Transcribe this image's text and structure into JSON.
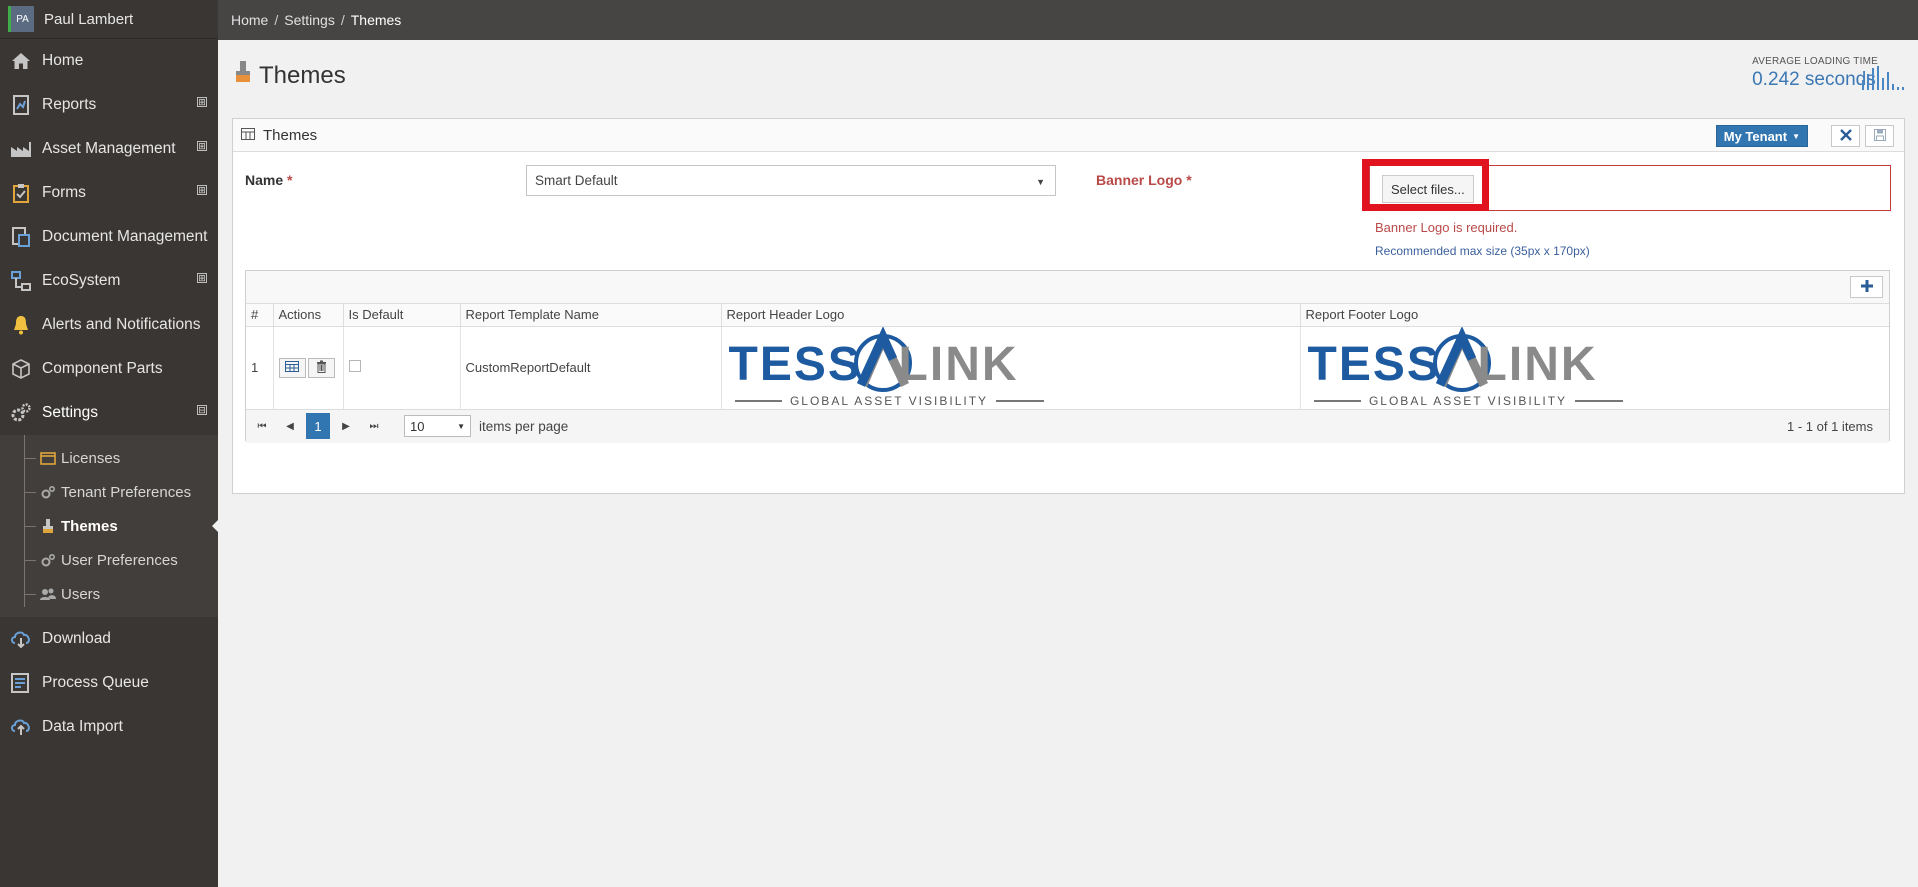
{
  "user": {
    "initials": "PA",
    "name": "Paul Lambert"
  },
  "sidebar": {
    "items": [
      {
        "label": "Home",
        "icon": "home-icon"
      },
      {
        "label": "Reports",
        "icon": "reports-icon",
        "expandable": "⊞"
      },
      {
        "label": "Asset Management",
        "icon": "factory-icon",
        "expandable": "⊞"
      },
      {
        "label": "Forms",
        "icon": "clipboard-icon",
        "expandable": "⊞"
      },
      {
        "label": "Document Management",
        "icon": "document-icon"
      },
      {
        "label": "EcoSystem",
        "icon": "network-icon",
        "expandable": "⊞"
      },
      {
        "label": "Alerts and Notifications",
        "icon": "bell-icon"
      },
      {
        "label": "Component Parts",
        "icon": "cube-icon"
      },
      {
        "label": "Settings",
        "icon": "gears-icon",
        "expandable": "⊟"
      },
      {
        "label": "Download",
        "icon": "cloud-download-icon"
      },
      {
        "label": "Process Queue",
        "icon": "queue-icon"
      },
      {
        "label": "Data Import",
        "icon": "cloud-upload-icon"
      }
    ],
    "settings_sub": [
      {
        "label": "Licenses"
      },
      {
        "label": "Tenant Preferences"
      },
      {
        "label": "Themes"
      },
      {
        "label": "User Preferences"
      },
      {
        "label": "Users"
      }
    ]
  },
  "breadcrumb": [
    "Home",
    "Settings",
    "Themes"
  ],
  "page": {
    "title": "Themes",
    "loading_label": "AVERAGE LOADING TIME",
    "loading_value": "0.242 seconds"
  },
  "panel": {
    "title": "Themes",
    "tenant_button": "My Tenant",
    "name_label": "Name",
    "required_mark": "*",
    "name_value": "Smart Default",
    "banner_label": "Banner Logo",
    "select_files": "Select files...",
    "banner_error": "Banner Logo is required.",
    "banner_hint": "Recommended max size (35px x 170px)"
  },
  "grid": {
    "columns": [
      "#",
      "Actions",
      "Is Default",
      "Report Template Name",
      "Report Header Logo",
      "Report Footer Logo"
    ],
    "rows": [
      {
        "num": "1",
        "template": "CustomReportDefault",
        "logo_word": "TESSALINK",
        "logo_tag": "GLOBAL ASSET VISIBILITY"
      }
    ],
    "pager": {
      "page": "1",
      "per_page": "10",
      "per_page_label": "items per page",
      "info": "1 - 1 of 1 items"
    }
  },
  "colors": {
    "accent": "#3276b1",
    "error": "#b94a48",
    "highlight": "#e0131f",
    "sidebar": "#3a3633"
  }
}
